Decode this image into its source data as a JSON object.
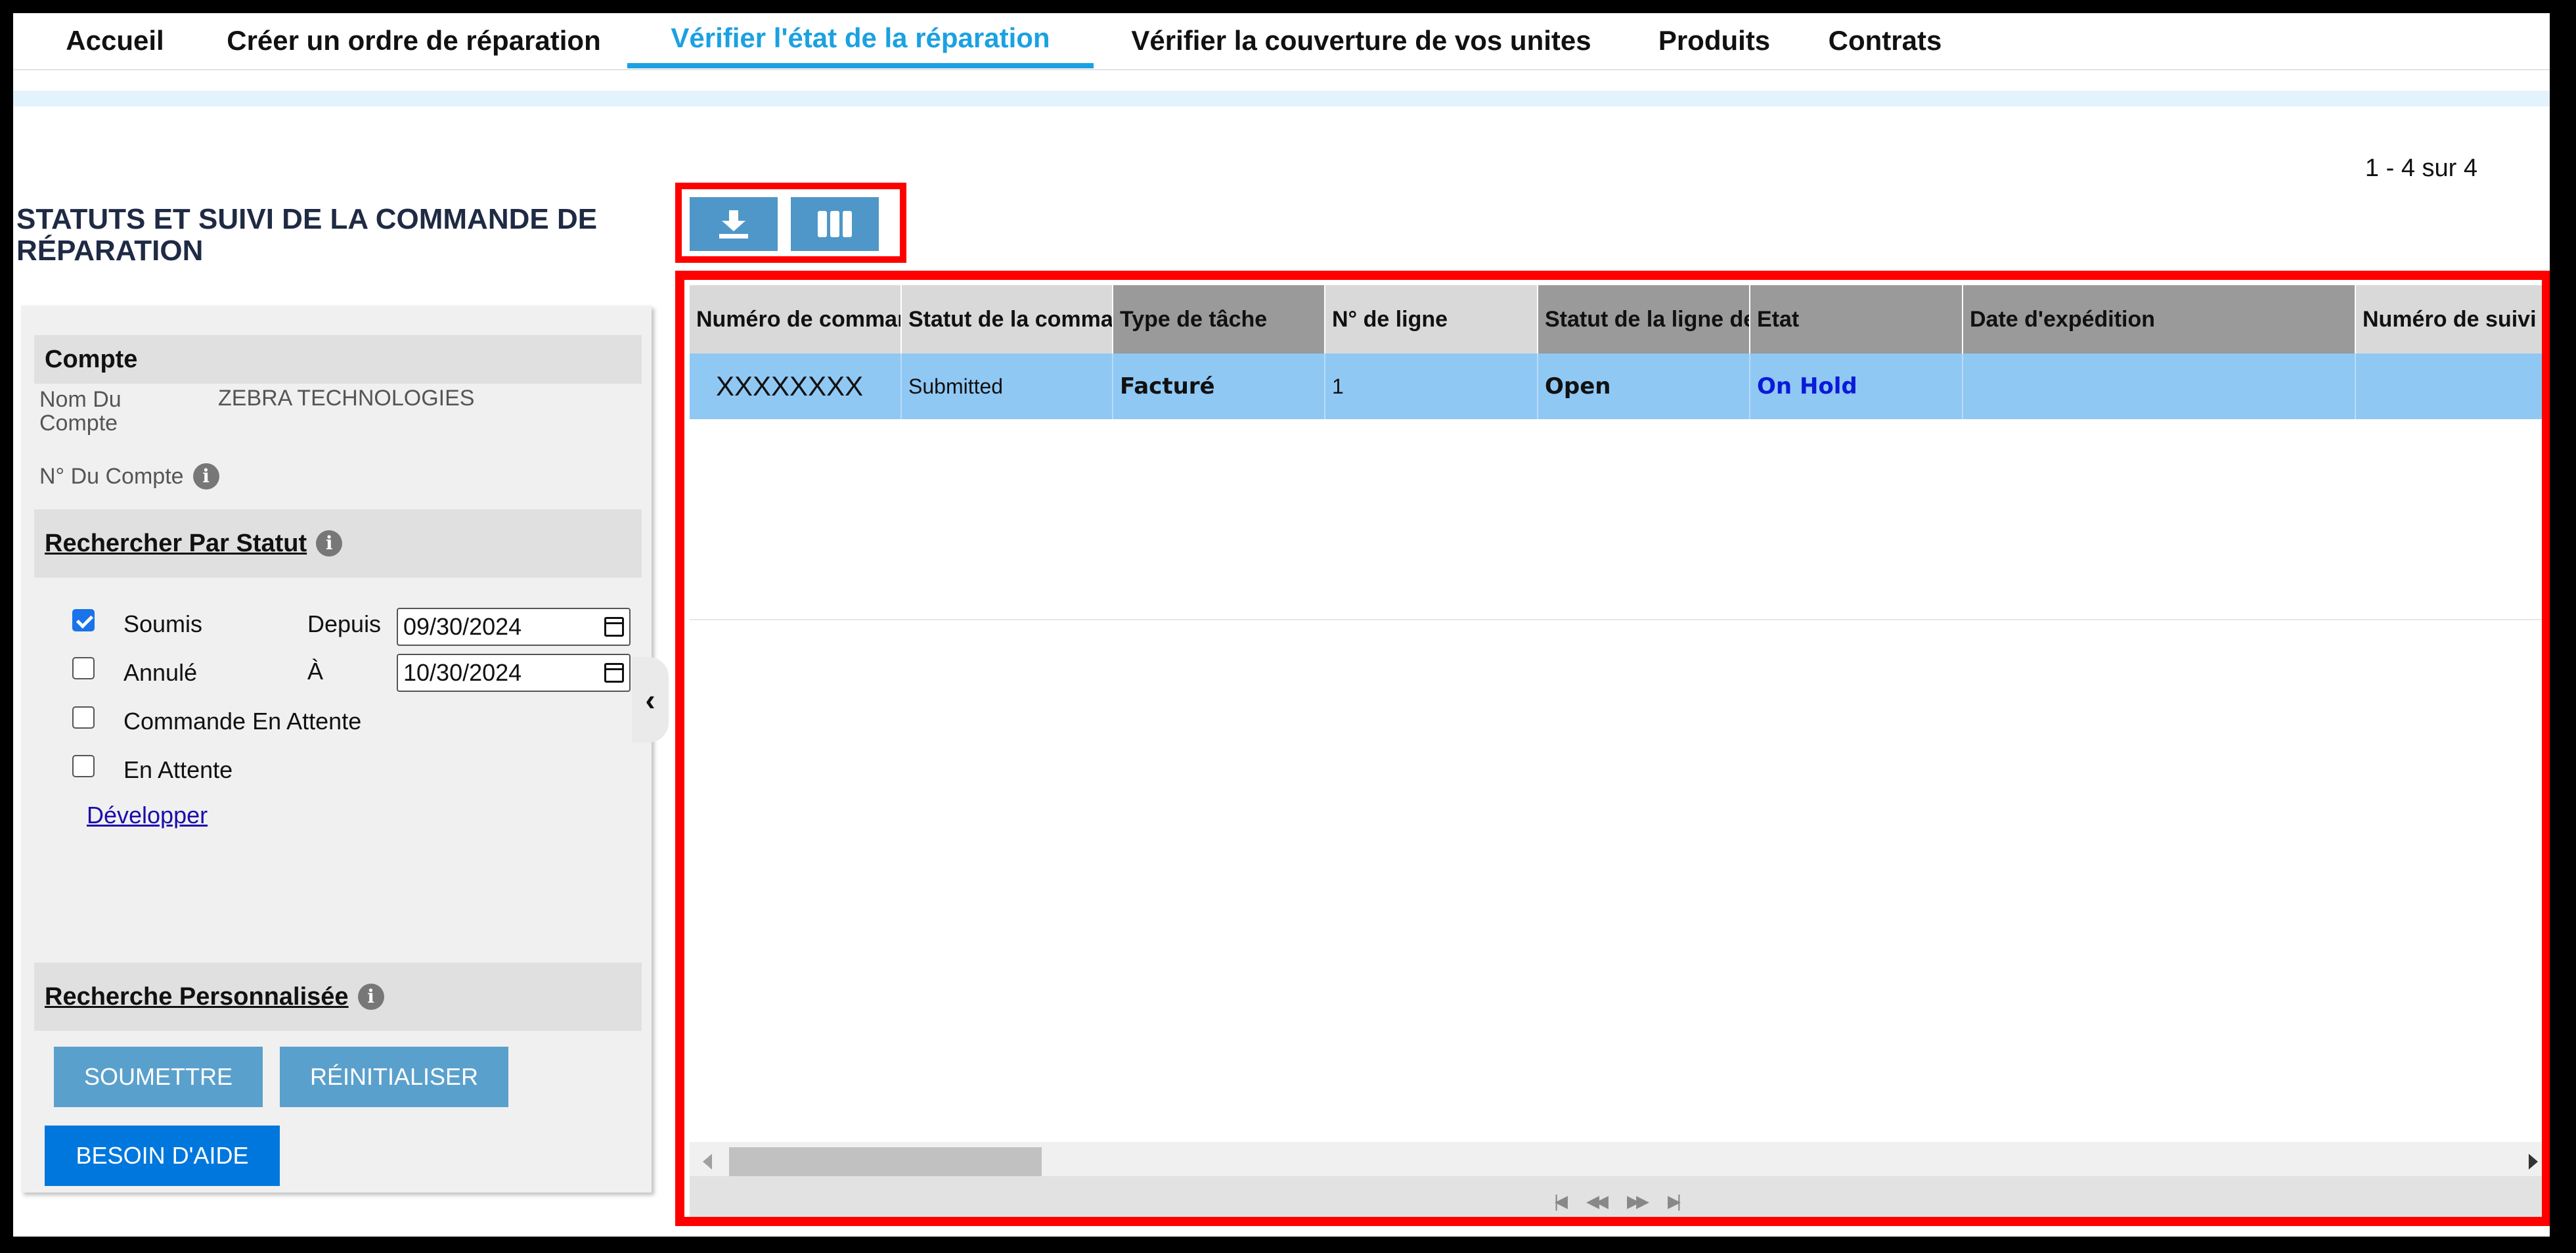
{
  "nav": {
    "tabs": [
      {
        "label": "Accueil"
      },
      {
        "label": "Créer un ordre de réparation"
      },
      {
        "label": "Vérifier l'état de la réparation"
      },
      {
        "label": "Vérifier la couverture de vos unites"
      },
      {
        "label": "Produits"
      },
      {
        "label": "Contrats"
      }
    ],
    "active_index": 2
  },
  "pager": {
    "range_text": "1 - 4 sur 4"
  },
  "page_title": "STATUTS ET SUIVI DE LA COMMANDE DE RÉPARATION",
  "sidebar": {
    "account": {
      "heading": "Compte",
      "name_label": "Nom Du Compte",
      "name_value": "ZEBRA TECHNOLOGIES",
      "number_label": "N° Du Compte"
    },
    "status_search": {
      "heading": "Rechercher Par Statut",
      "checkboxes": [
        {
          "label": "Soumis",
          "checked": true
        },
        {
          "label": "Annulé",
          "checked": false
        },
        {
          "label": "Commande En Attente",
          "checked": false
        },
        {
          "label": "En Attente",
          "checked": false
        }
      ],
      "from_label": "Depuis",
      "from_value": "09/30/2024",
      "to_label": "À",
      "to_value": "10/30/2024",
      "expand_link": "Développer"
    },
    "custom_search": {
      "heading": "Recherche Personnalisée"
    },
    "buttons": {
      "submit": "SOUMETTRE",
      "reset": "RÉINITIALISER",
      "help": "BESOIN D'AIDE"
    }
  },
  "toolbar": {
    "download_icon": "download-icon",
    "columns_icon": "columns-icon"
  },
  "grid": {
    "columns": [
      "Numéro de commande",
      "Statut de la commande",
      "Type de tâche",
      "N° de ligne",
      "Statut de la ligne de",
      "Etat",
      "Date d'expédition",
      "Numéro de suivi"
    ],
    "rows": [
      [
        "XXXXXXXX",
        "Submitted",
        "Facturé",
        "1",
        "Open",
        "On Hold",
        "",
        ""
      ]
    ]
  },
  "colors": {
    "accent": "#1ba1e2",
    "highlight_border": "#ff0000",
    "row_selected": "#90c8f4"
  }
}
